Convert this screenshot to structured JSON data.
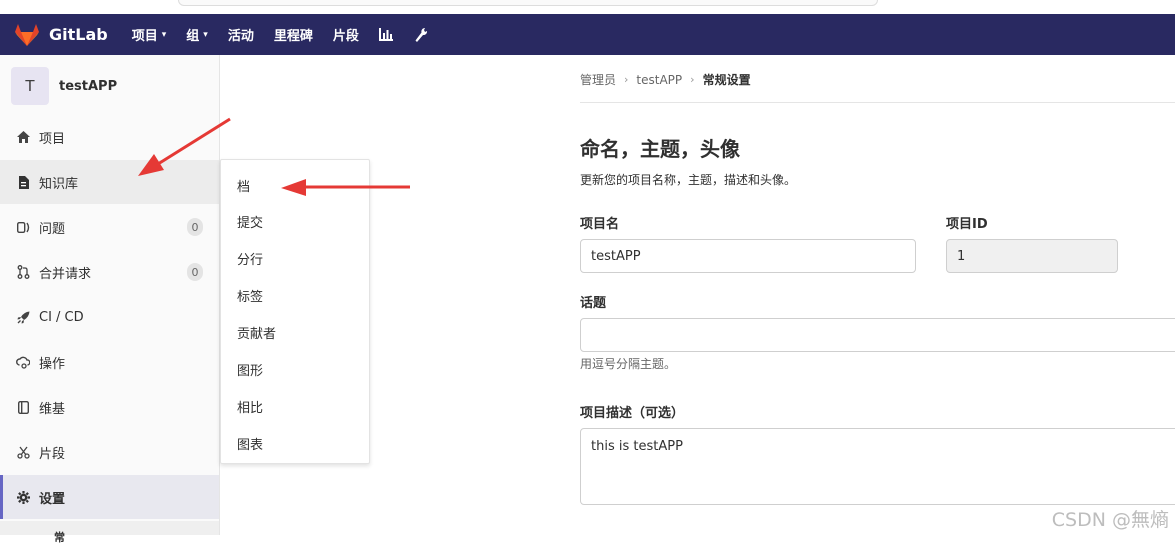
{
  "navbar": {
    "brand": "GitLab",
    "items": [
      {
        "label": "项目",
        "has_caret": true
      },
      {
        "label": "组",
        "has_caret": true
      },
      {
        "label": "活动",
        "has_caret": false
      },
      {
        "label": "里程碑",
        "has_caret": false
      },
      {
        "label": "片段",
        "has_caret": false
      }
    ],
    "icons": [
      "chart-icon",
      "wrench-icon"
    ],
    "colors": {
      "background": "#292961",
      "logo": "#e24329"
    }
  },
  "sidebar": {
    "project_avatar_letter": "T",
    "project_name": "testAPP",
    "items": [
      {
        "label": "项目",
        "icon": "home-icon"
      },
      {
        "label": "知识库",
        "icon": "document-icon",
        "active": true
      },
      {
        "label": "问题",
        "icon": "issues-icon",
        "count": "0"
      },
      {
        "label": "合并请求",
        "icon": "merge-request-icon",
        "count": "0"
      },
      {
        "label": "CI / CD",
        "icon": "rocket-icon"
      },
      {
        "label": "操作",
        "icon": "cloud-gear-icon"
      },
      {
        "label": "维基",
        "icon": "book-icon"
      },
      {
        "label": "片段",
        "icon": "scissors-icon"
      },
      {
        "label": "设置",
        "icon": "gear-icon",
        "selected": true
      }
    ],
    "sub_peek": "常"
  },
  "flyout": {
    "items": [
      "档",
      "提交",
      "分行",
      "标签",
      "贡献者",
      "图形",
      "相比",
      "图表"
    ]
  },
  "breadcrumb": {
    "items": [
      "管理员",
      "testAPP",
      "常规设置"
    ]
  },
  "main": {
    "section_title": "命名，主题，头像",
    "section_subtitle": "更新您的项目名称，主题，描述和头像。",
    "project_name_label": "项目名",
    "project_name_value": "testAPP",
    "project_id_label": "项目ID",
    "project_id_value": "1",
    "topics_label": "话题",
    "topics_value": "",
    "topics_hint": "用逗号分隔主题。",
    "description_label": "项目描述（可选）",
    "description_value": "this is testAPP"
  },
  "watermark": "CSDN @無熵"
}
